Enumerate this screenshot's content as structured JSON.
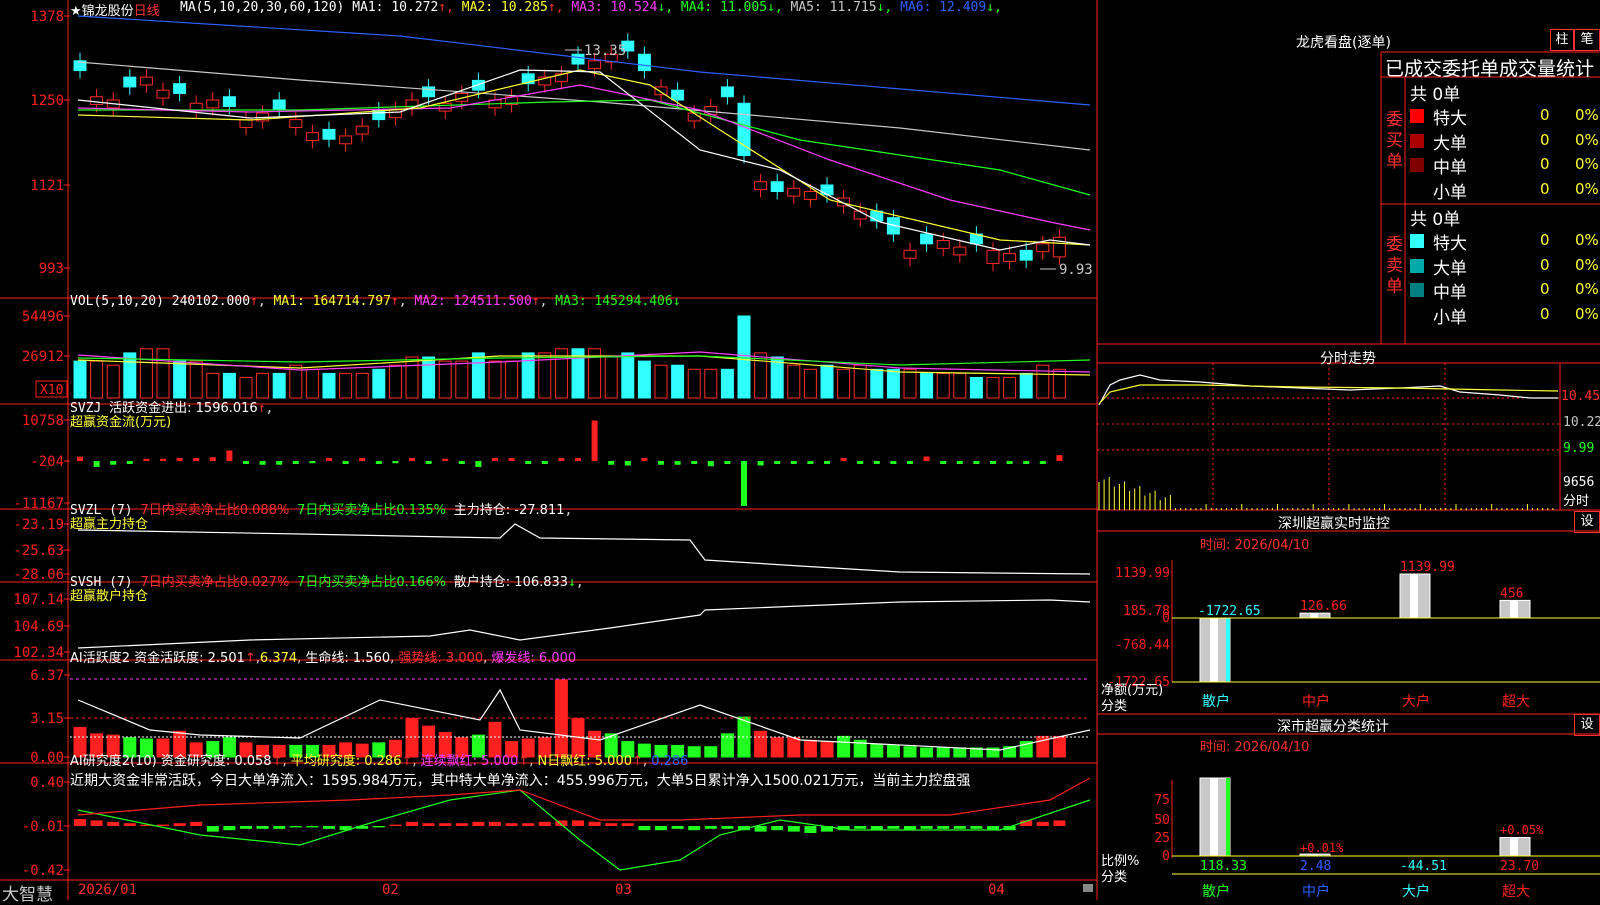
{
  "stock": {
    "name": "锦龙股份",
    "star": "★",
    "period": "日线"
  },
  "main_ma": {
    "label": "MA(5,10,20,30,60,120)",
    "items": [
      {
        "text": "MA1: 10.272",
        "arrow": "↑",
        "color": "#ffffff"
      },
      {
        "text": "MA2: 10.285",
        "arrow": "↑",
        "color": "#ffff33"
      },
      {
        "text": "MA3: 10.524",
        "arrow": "↓",
        "color": "#ff40ff"
      },
      {
        "text": "MA4: 11.005",
        "arrow": "↓",
        "color": "#20ff20"
      },
      {
        "text": "MA5: 11.715",
        "arrow": "↓",
        "color": "#c8c8c8"
      },
      {
        "text": "MA6: 12.409",
        "arrow": "↓",
        "color": "#3060ff"
      }
    ],
    "axis": [
      "1378",
      "1250",
      "1121",
      "993"
    ],
    "high_label": "13.35",
    "low_label": "9.93"
  },
  "vol": {
    "label": "VOL(5,10,20)",
    "value": "240102.000",
    "ma1": "MA1: 164714.797",
    "ma2": "MA2: 124511.500",
    "ma3": "MA3: 145294.406",
    "axis": [
      "54496",
      "26912"
    ],
    "unit": "X10"
  },
  "svzj": {
    "label": "SVZJ",
    "text": "活跃资金进出: 1596.016",
    "sub": "超赢资金流(万元)",
    "axis": [
      "10758",
      "-204",
      "-11167"
    ]
  },
  "svzl": {
    "label": "SVZL (7)",
    "t1": "7日内买卖净占比0.088%",
    "t2": "7日内买卖净占比0.135%",
    "t3": "主力持仓: -27.811",
    "sub": "超赢主力持仓",
    "axis": [
      "-23.19",
      "-25.63",
      "-28.06"
    ]
  },
  "svsh": {
    "label": "SVSH (7)",
    "t1": "7日内买卖净占比0.027%",
    "t2": "7日内买卖净占比0.166%",
    "t3": "散户持仓: 106.833",
    "axis": [
      "107.14",
      "104.69",
      "102.34"
    ],
    "sub": "超赢散户持仓"
  },
  "ai1": {
    "label": "AI活跃度2",
    "t1": "资金活跃度: 2.501",
    "t2": "6.374",
    "t3": "生命线: 1.560",
    "t4": "强势线: 3.000",
    "t5": "爆发线: 6.000",
    "axis": [
      "6.37",
      "3.15",
      "0.00"
    ]
  },
  "ai2": {
    "label": "AI研究度2(10)",
    "t1": "资金研究度: 0.058",
    "t2": "平均研究度: 0.286",
    "t3": "连续飘红: 5.000",
    "t4": "N日飘红: 5.000",
    "t5": "0.286",
    "note": "近期大资金非常活跃，今日大单净流入：1595.984万元，其中特大单净流入：455.996万元，大单5日累计净入1500.021万元，当前主力控盘强",
    "axis": [
      "0.40",
      "-0.01",
      "-0.42"
    ]
  },
  "footer": {
    "brand": "大智慧",
    "dates": [
      "2026/01",
      "02",
      "03",
      "04"
    ]
  },
  "lhb": {
    "title": "龙虎看盘(逐单)",
    "btn1": "柱",
    "btn2": "笔",
    "head": "已成交委托单成交量统计",
    "buy_label": "委买单",
    "sell_label": "委卖单",
    "buy_total": "共 0单",
    "sell_total": "共 0单",
    "buy_rows": [
      {
        "name": "特大",
        "count": "0",
        "pct": "0%",
        "color": "#ff0000"
      },
      {
        "name": "大单",
        "count": "0",
        "pct": "0%",
        "color": "#aa0000"
      },
      {
        "name": "中单",
        "count": "0",
        "pct": "0%",
        "color": "#800000"
      },
      {
        "name": "小单",
        "count": "0",
        "pct": "0%",
        "color": "#000000"
      }
    ],
    "sell_rows": [
      {
        "name": "特大",
        "count": "0",
        "pct": "0%",
        "color": "#30ffff"
      },
      {
        "name": "大单",
        "count": "0",
        "pct": "0%",
        "color": "#00aaaa"
      },
      {
        "name": "中单",
        "count": "0",
        "pct": "0%",
        "color": "#008080"
      },
      {
        "name": "小单",
        "count": "0",
        "pct": "0%",
        "color": "#000000"
      }
    ]
  },
  "fsz": {
    "title": "分时走势",
    "axis": [
      "10.45",
      "10.22",
      "9.99"
    ],
    "vol_label": "9656",
    "vol_sub": "分时"
  },
  "monitor": {
    "title": "深圳超赢实时监控",
    "btn": "设",
    "time": "时间: 2026/04/10",
    "axis": [
      "1139.99",
      "185.78",
      "0",
      "-768.44",
      "-1722.65"
    ],
    "ylabel": "净额(万元)",
    "xlabel": "分类",
    "cats": [
      "散户",
      "中户",
      "大户",
      "超大"
    ],
    "values": [
      -1722.65,
      126.66,
      1139.99,
      456
    ],
    "value_labels": [
      "-1722.65",
      "126.66",
      "1139.99",
      "456"
    ]
  },
  "classify": {
    "title": "深市超赢分类统计",
    "btn": "设",
    "time": "时间: 2026/04/10",
    "axis": [
      "75",
      "50",
      "25",
      "0"
    ],
    "ylabel": "比例%",
    "xlabel": "分类",
    "cats": [
      "散户",
      "中户",
      "大户",
      "超大"
    ],
    "values": [
      118.33,
      2.48,
      -44.51,
      23.7
    ],
    "value_labels": [
      "118.33",
      "2.48",
      "-44.51",
      "23.70"
    ],
    "pct_labels": [
      "+0.01%",
      "+0.05%"
    ]
  }
}
